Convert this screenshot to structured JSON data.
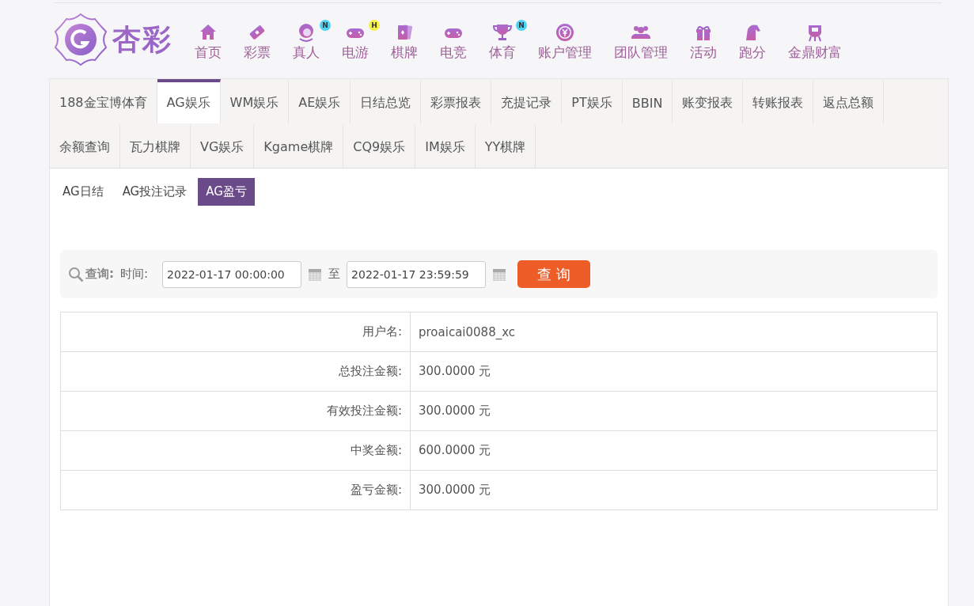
{
  "logo": {
    "text": "杏彩"
  },
  "nav": [
    {
      "label": "首页"
    },
    {
      "label": "彩票"
    },
    {
      "label": "真人",
      "badge": "N",
      "color": "#4fd3f0"
    },
    {
      "label": "电游",
      "badge": "H",
      "color": "#f4f04a"
    },
    {
      "label": "棋牌"
    },
    {
      "label": "电竞"
    },
    {
      "label": "体育",
      "badge": "N",
      "color": "#4fd3f0"
    },
    {
      "label": "账户管理"
    },
    {
      "label": "团队管理"
    },
    {
      "label": "活动"
    },
    {
      "label": "跑分"
    },
    {
      "label": "金鼎财富"
    }
  ],
  "tabs": [
    {
      "label": "188金宝博体育",
      "selected": false
    },
    {
      "label": "AG娱乐",
      "selected": true
    },
    {
      "label": "WM娱乐",
      "selected": false
    },
    {
      "label": "AE娱乐",
      "selected": false
    },
    {
      "label": "日结总览",
      "selected": false
    },
    {
      "label": "彩票报表",
      "selected": false
    },
    {
      "label": "充提记录",
      "selected": false
    },
    {
      "label": "PT娱乐",
      "selected": false
    },
    {
      "label": "BBIN",
      "selected": false
    },
    {
      "label": "账变报表",
      "selected": false
    },
    {
      "label": "转账报表",
      "selected": false
    },
    {
      "label": "返点总额",
      "selected": false
    },
    {
      "label": "余额查询",
      "selected": false
    },
    {
      "label": "瓦力棋牌",
      "selected": false
    },
    {
      "label": "VG娱乐",
      "selected": false
    },
    {
      "label": "Kgame棋牌",
      "selected": false
    },
    {
      "label": "CQ9娱乐",
      "selected": false
    },
    {
      "label": "IM娱乐",
      "selected": false
    },
    {
      "label": "YY棋牌",
      "selected": false
    }
  ],
  "subtabs": [
    {
      "label": "AG日结",
      "selected": false
    },
    {
      "label": "AG投注记录",
      "selected": false
    },
    {
      "label": "AG盈亏",
      "selected": true
    }
  ],
  "query": {
    "label": "查询:",
    "time_label": "时间:",
    "start": "2022-01-17 00:00:00",
    "separator": "至",
    "end": "2022-01-17 23:59:59",
    "button": "查 询"
  },
  "table": {
    "rows": [
      {
        "label": "用户名:",
        "value": "proaicai0088_xc"
      },
      {
        "label": "总投注金额:",
        "value": "300.0000 元"
      },
      {
        "label": "有效投注金额:",
        "value": "300.0000 元"
      },
      {
        "label": "中奖金额:",
        "value": "600.0000 元"
      },
      {
        "label": "盈亏金额:",
        "value": "300.0000 元"
      }
    ]
  }
}
